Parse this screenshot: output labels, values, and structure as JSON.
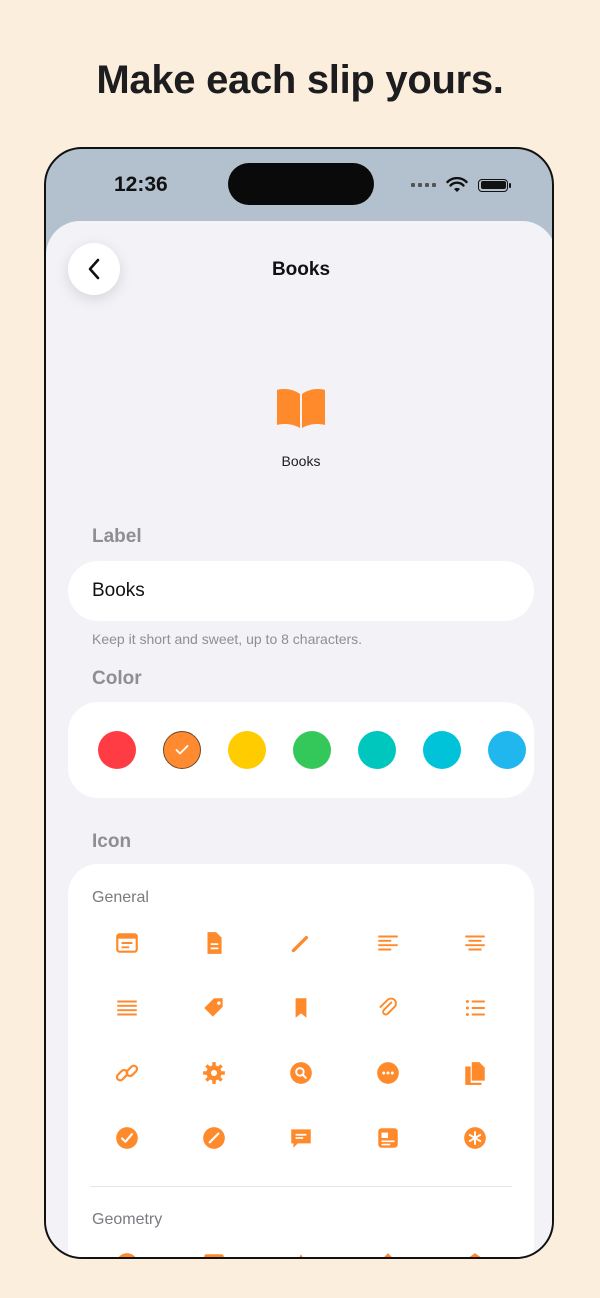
{
  "headline": "Make each slip yours.",
  "status": {
    "time": "12:36"
  },
  "nav": {
    "title": "Books"
  },
  "preview": {
    "label": "Books",
    "icon": "book-icon"
  },
  "label_section": {
    "header": "Label",
    "value": "Books",
    "hint": "Keep it short and sweet, up to 8 characters."
  },
  "color_section": {
    "header": "Color",
    "selected_index": 1,
    "swatches": [
      "#ff3b43",
      "#ff8a30",
      "#ffcc00",
      "#34c759",
      "#00c7be",
      "#00c3d9",
      "#20b7ee"
    ]
  },
  "icon_section": {
    "header": "Icon",
    "accent": "#ff8a2b",
    "groups": [
      {
        "title": "General",
        "icons": [
          "window-icon",
          "document-icon",
          "pencil-icon",
          "align-left-icon",
          "align-center-icon",
          "lines-icon",
          "tag-icon",
          "bookmark-icon",
          "paperclip-icon",
          "list-icon",
          "link-icon",
          "gear-icon",
          "search-circle-icon",
          "ellipsis-circle-icon",
          "documents-icon",
          "checkmark-circle-icon",
          "pencil-circle-icon",
          "chat-bubble-icon",
          "news-icon",
          "asterisk-circle-icon"
        ]
      },
      {
        "title": "Geometry",
        "icons": [
          "circle-icon",
          "square-icon",
          "triangle-icon",
          "diamond-icon",
          "pentagon-icon"
        ]
      }
    ]
  }
}
